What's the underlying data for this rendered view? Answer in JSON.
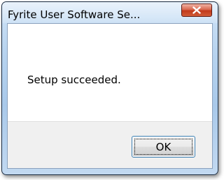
{
  "window": {
    "title": "Fyrite User Software Se...",
    "close_icon": "close-icon"
  },
  "dialog": {
    "message": "Setup succeeded.",
    "ok_label": "OK"
  },
  "colors": {
    "close_button": "#c1391b",
    "ok_border": "#3c7fb1",
    "footer_bg": "#f0f0f0"
  }
}
